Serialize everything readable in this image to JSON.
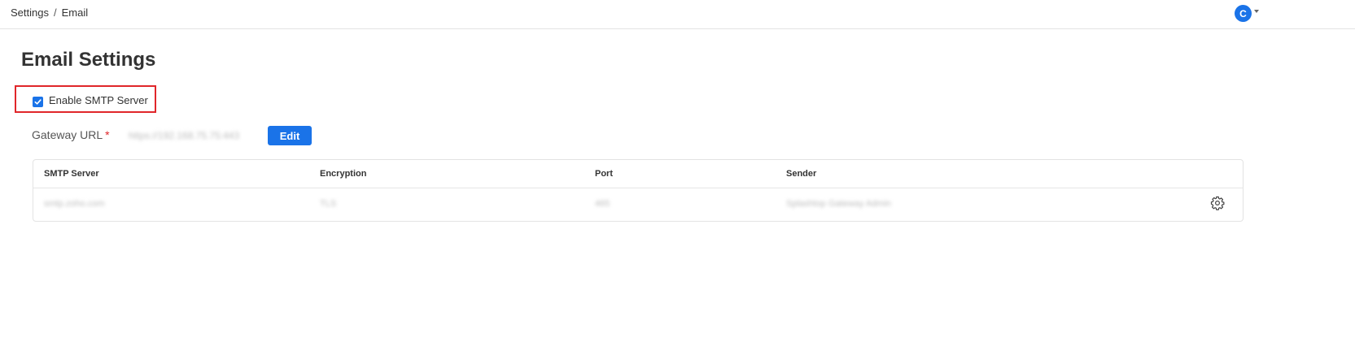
{
  "breadcrumb": {
    "parent": "Settings",
    "separator": "/",
    "current": "Email"
  },
  "user": {
    "avatar_initial": "C"
  },
  "page_title": "Email Settings",
  "smtp": {
    "enable_label": "Enable SMTP Server",
    "checked": true
  },
  "gateway": {
    "label": "Gateway URL",
    "required_mark": "*",
    "value": "https://192.168.75.75:443",
    "edit_label": "Edit"
  },
  "table": {
    "headers": [
      "SMTP Server",
      "Encryption",
      "Port",
      "Sender"
    ],
    "rows": [
      {
        "server": "smtp.zoho.com",
        "encryption": "TLS",
        "port": "465",
        "sender": "Splashtop Gateway Admin"
      }
    ]
  },
  "icons": {
    "row_action": "gear-icon",
    "checkbox": "checkmark-icon",
    "avatar_menu": "caret-down-icon"
  },
  "colors": {
    "accent": "#1a73e8",
    "highlight_border": "#e0262a",
    "required": "#e0262a"
  }
}
